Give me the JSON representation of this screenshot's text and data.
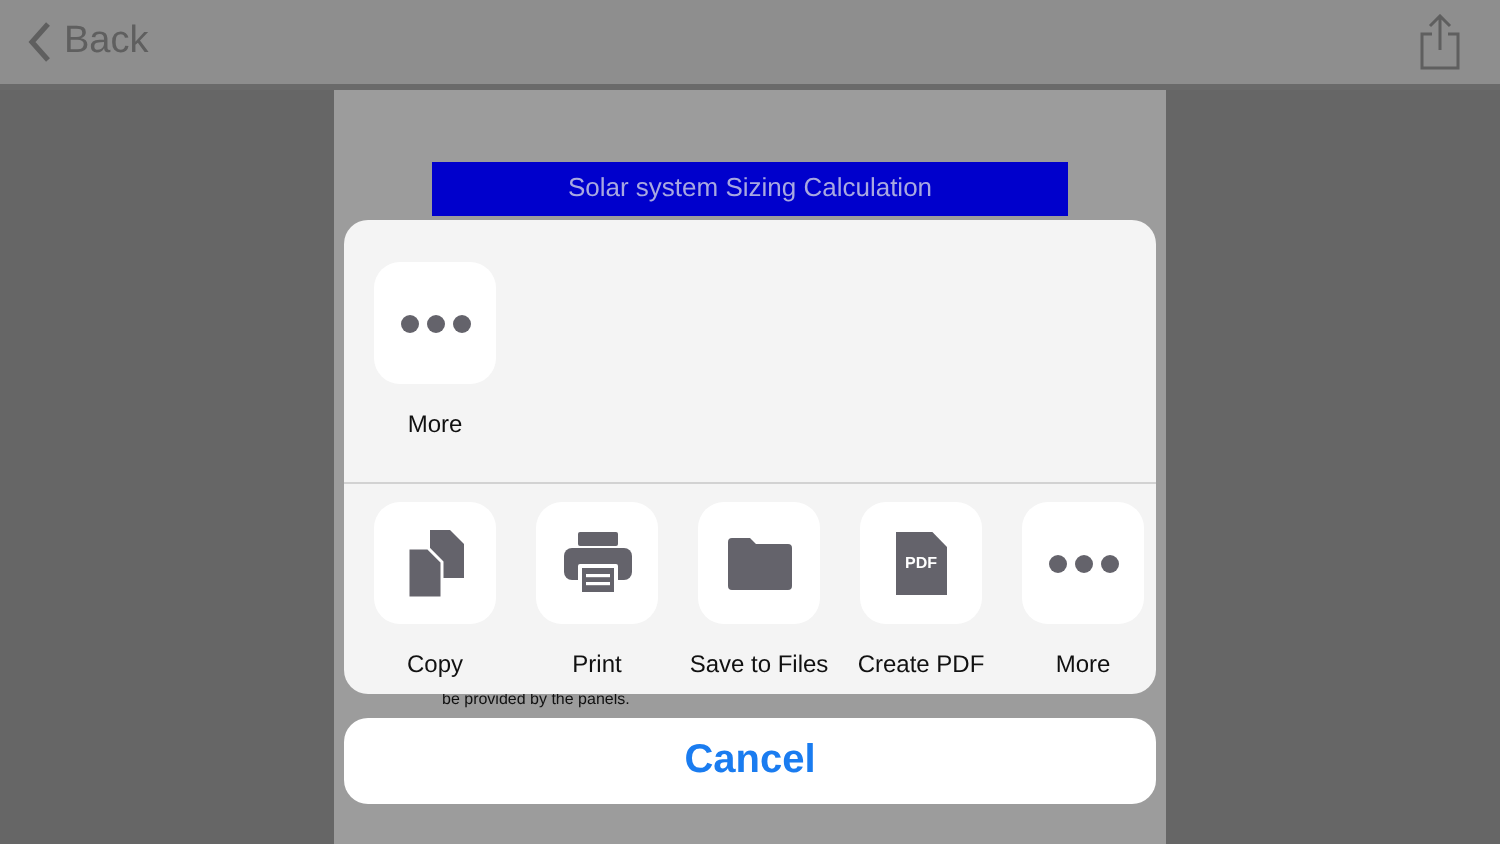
{
  "nav": {
    "back": "Back"
  },
  "document": {
    "title": "Solar system Sizing Calculation",
    "text": "be provided by the panels."
  },
  "share_sheet": {
    "top_row": [
      {
        "kind": "more",
        "label": "More"
      }
    ],
    "actions": [
      {
        "kind": "copy",
        "label": "Copy"
      },
      {
        "kind": "print",
        "label": "Print"
      },
      {
        "kind": "files",
        "label": "Save to Files"
      },
      {
        "kind": "pdf",
        "label": "Create PDF",
        "icon_text": "PDF"
      },
      {
        "kind": "more",
        "label": "More"
      }
    ],
    "cancel": "Cancel"
  }
}
